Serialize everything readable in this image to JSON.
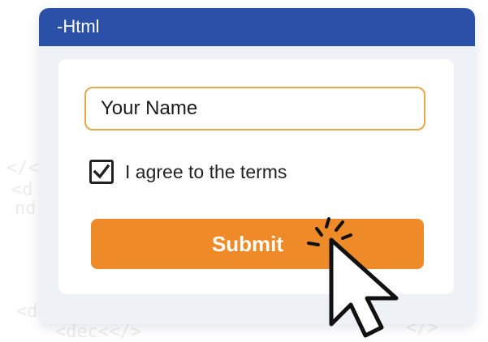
{
  "window": {
    "title": "-Html"
  },
  "form": {
    "name_field": {
      "placeholder": "Your Name",
      "value": ""
    },
    "terms_checkbox": {
      "label": "I agree to the terms",
      "checked": true
    },
    "submit_label": "Submit"
  },
  "colors": {
    "titlebar": "#2a50a8",
    "accent": "#ef8a28",
    "field_border": "#e8a84c"
  },
  "icons": [
    "checkmark-icon",
    "mouse-pointer-icon",
    "click-burst-icon"
  ]
}
